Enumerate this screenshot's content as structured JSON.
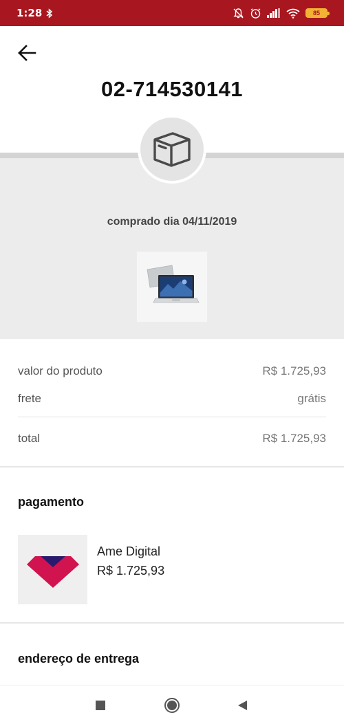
{
  "status_bar": {
    "time": "1:28",
    "battery_level": "85"
  },
  "header": {
    "back_icon": "arrow-left-icon",
    "order_number": "02-714530141"
  },
  "order_summary": {
    "status_icon": "package-box-icon",
    "purchase_date": "comprado dia 04/11/2019",
    "product_image": "laptop-product-image"
  },
  "pricing": {
    "product_value_label": "valor do produto",
    "product_value": "R$ 1.725,93",
    "shipping_label": "frete",
    "shipping_value": "grátis",
    "total_label": "total",
    "total_value": "R$ 1.725,93"
  },
  "payment": {
    "title": "pagamento",
    "method_logo": "ame-digital-logo",
    "method_name": "Ame Digital",
    "amount": "R$ 1.725,93"
  },
  "delivery": {
    "title": "endereço de entrega"
  },
  "colors": {
    "status_bar": "#a8171f",
    "gray_area": "#ececec",
    "ame_pink": "#d1134f",
    "ame_navy": "#2a1a6e"
  }
}
